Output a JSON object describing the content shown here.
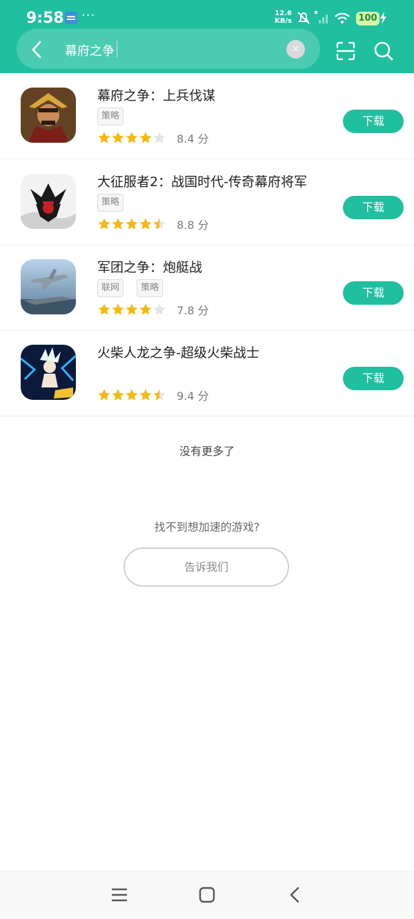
{
  "status": {
    "time": "9:58",
    "net_speed_value": "12.6",
    "net_speed_unit": "KB/s",
    "battery": "100"
  },
  "search": {
    "query": "幕府之争"
  },
  "results": [
    {
      "title": "幕府之争：上兵伐谋",
      "tags": [
        "策略"
      ],
      "rating": 4.0,
      "score": "8.4 分",
      "button": "下载"
    },
    {
      "title": "大征服者2：战国时代-传奇幕府将军",
      "tags": [
        "策略"
      ],
      "rating": 4.5,
      "score": "8.8 分",
      "button": "下载"
    },
    {
      "title": "军团之争：炮艇战",
      "tags": [
        "联网",
        "策略"
      ],
      "rating": 4.0,
      "score": "7.8 分",
      "button": "下载"
    },
    {
      "title": "火柴人龙之争-超级火柴战士",
      "tags": [],
      "rating": 4.5,
      "score": "9.4 分",
      "button": "下载"
    }
  ],
  "footer": {
    "no_more": "没有更多了",
    "cant_find": "找不到想加速的游戏?",
    "tell_us": "告诉我们"
  },
  "icons": {
    "star_color": "#f6b90f",
    "star_empty_color": "#e4e4e4",
    "accent": "#1fbf9f"
  }
}
